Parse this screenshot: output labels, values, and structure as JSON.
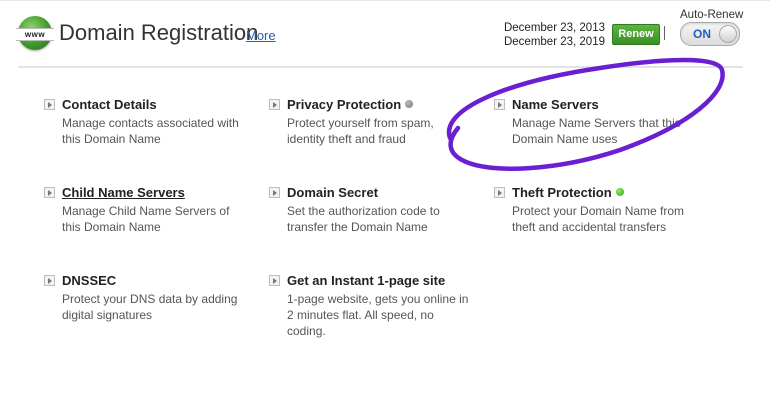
{
  "header": {
    "icon_text": "www",
    "title": "Domain Registration",
    "more_link": "More",
    "date_start": "December 23, 2013",
    "date_end": "December 23, 2019",
    "renew_label": "Renew",
    "auto_renew_label": "Auto-Renew",
    "auto_renew_state": "ON"
  },
  "items": [
    {
      "title": "Contact Details",
      "desc": "Manage contacts associated with this Domain Name",
      "status": null
    },
    {
      "title": "Privacy Protection",
      "desc": "Protect yourself from spam, identity theft and fraud",
      "status": "gray"
    },
    {
      "title": "Name Servers",
      "desc": "Manage Name Servers that this Domain Name uses",
      "status": null
    },
    {
      "title": "Child Name Servers",
      "desc": "Manage Child Name Servers of this Domain Name",
      "status": null
    },
    {
      "title": "Domain Secret",
      "desc": "Set the authorization code to transfer the Domain Name",
      "status": null
    },
    {
      "title": "Theft Protection",
      "desc": "Protect your Domain Name from theft and accidental transfers",
      "status": "green"
    },
    {
      "title": "DNSSEC",
      "desc": "Protect your DNS data by adding digital signatures",
      "status": null
    },
    {
      "title": "Get an Instant 1-page site",
      "desc": "1-page website, gets you online in 2 minutes flat. All speed, no coding.",
      "status": null
    }
  ],
  "colors": {
    "renew_button": "#4aa332",
    "link": "#2a5db0",
    "annotation": "#6a1fd1",
    "status_gray": "#888888",
    "status_green": "#2aa31a"
  }
}
